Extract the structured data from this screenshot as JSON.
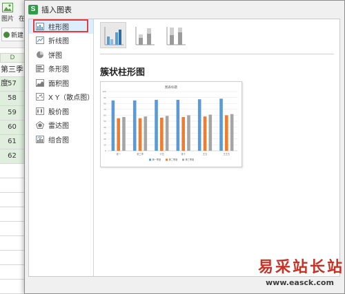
{
  "background": {
    "tabs": [
      "图片",
      "在"
    ],
    "new_button_label": "新建",
    "column_header": "D",
    "column_heading_cell": "第三季度",
    "cells": [
      "57",
      "58",
      "59",
      "60",
      "61",
      "62"
    ]
  },
  "dialog": {
    "logo_letter": "S",
    "title": "插入图表",
    "sidebar": [
      {
        "label": "柱形图",
        "icon": "column-chart-icon",
        "active": true
      },
      {
        "label": "折线图",
        "icon": "line-chart-icon",
        "active": false
      },
      {
        "label": "饼图",
        "icon": "pie-chart-icon",
        "active": false
      },
      {
        "label": "条形图",
        "icon": "bar-chart-icon",
        "active": false
      },
      {
        "label": "面积图",
        "icon": "area-chart-icon",
        "active": false
      },
      {
        "label": "X Y（散点图）",
        "icon": "scatter-chart-icon",
        "active": false
      },
      {
        "label": "股价图",
        "icon": "stock-chart-icon",
        "active": false
      },
      {
        "label": "雷达图",
        "icon": "radar-chart-icon",
        "active": false
      },
      {
        "label": "组合图",
        "icon": "combo-chart-icon",
        "active": false
      }
    ],
    "subtypes": [
      {
        "icon": "clustered-column-icon",
        "active": true
      },
      {
        "icon": "stacked-column-icon",
        "active": false
      },
      {
        "icon": "percent-stacked-column-icon",
        "active": false
      }
    ],
    "selected_chart_name": "簇状柱形图"
  },
  "colors": {
    "series1": "#5b9bd5",
    "series2": "#ed7d31",
    "series3": "#a5a5a5",
    "highlight_box": "#e23b3b",
    "sidebar_active": "#dceefe"
  },
  "chart_data": {
    "type": "bar",
    "title": "图表标题",
    "categories": [
      "张一",
      "张三李",
      "十四",
      "张十",
      "王五",
      "王王五"
    ],
    "series": [
      {
        "name": "第一季度",
        "values": [
          85,
          85,
          86,
          86,
          87,
          88
        ]
      },
      {
        "name": "第二季度",
        "values": [
          55,
          55,
          56,
          57,
          58,
          60
        ]
      },
      {
        "name": "第三季度",
        "values": [
          57,
          58,
          59,
          60,
          61,
          62
        ]
      }
    ],
    "ylim": [
      0,
      100
    ],
    "yticks": [
      0,
      10,
      20,
      30,
      40,
      50,
      60,
      70,
      80,
      90,
      100
    ],
    "grid": true,
    "legend": "bottom"
  },
  "watermark": {
    "title": "易采站长站",
    "url": "www.easck.com"
  }
}
